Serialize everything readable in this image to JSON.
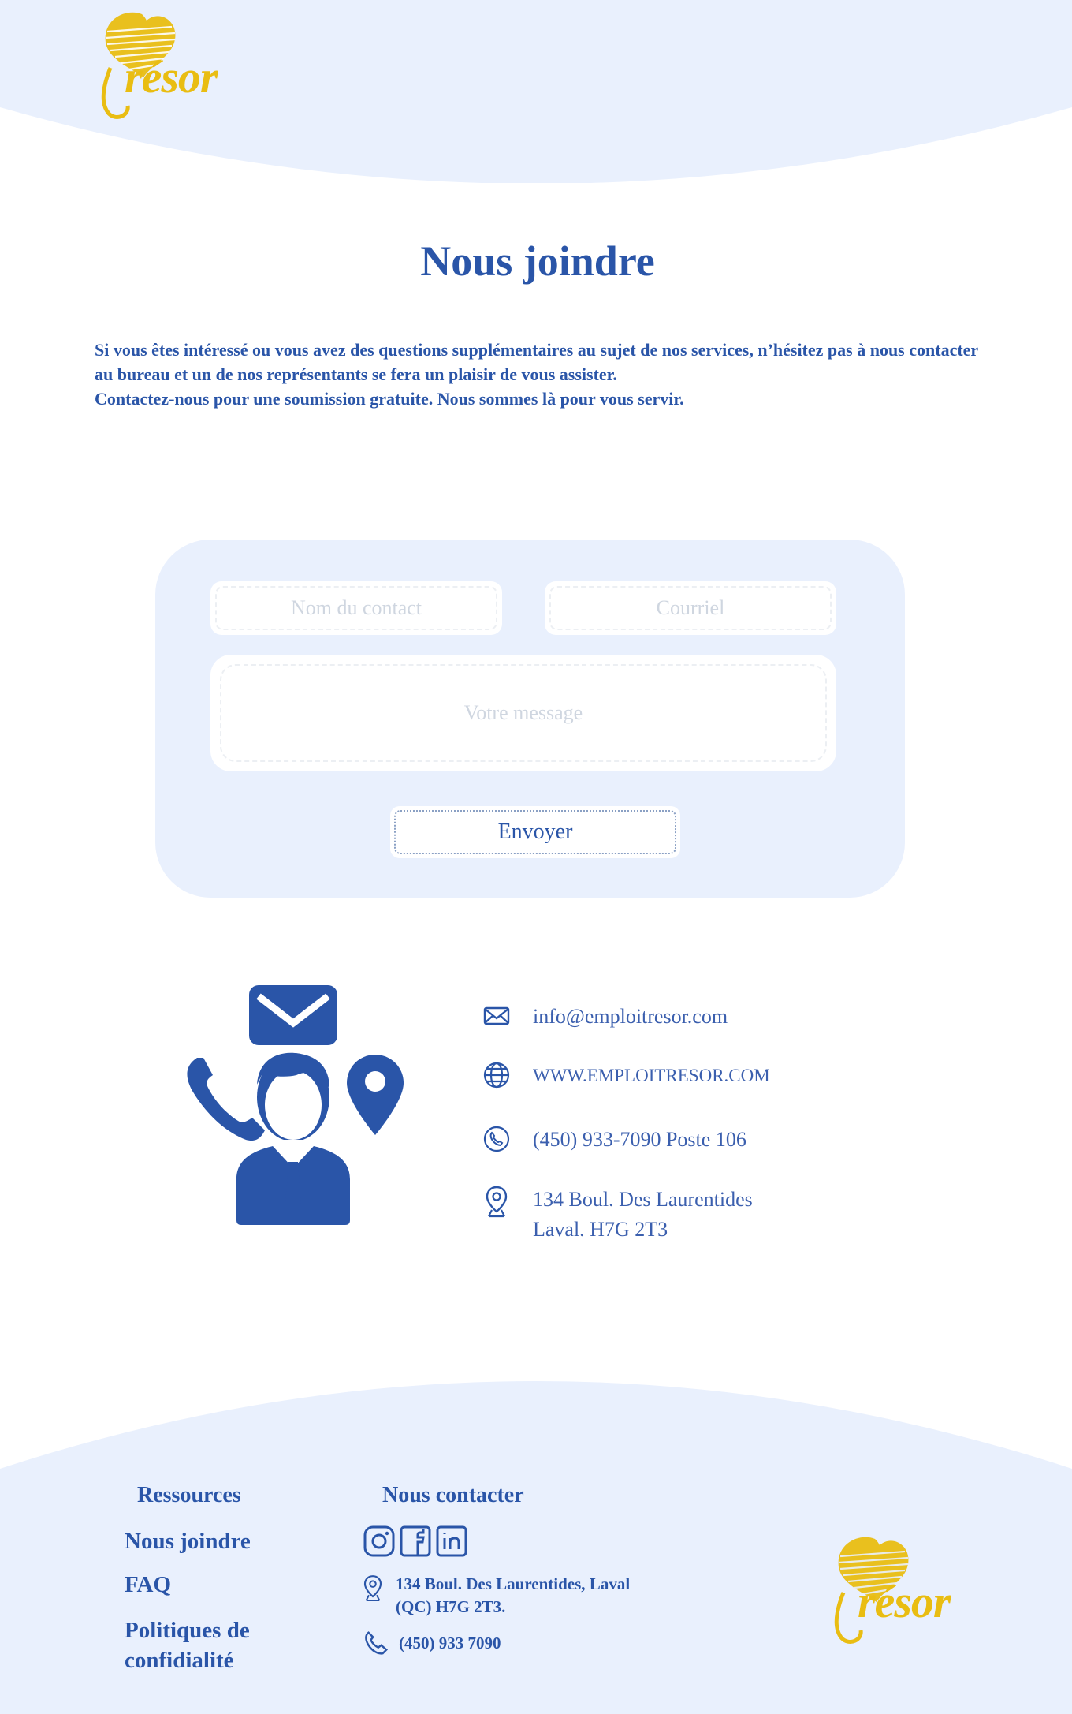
{
  "brand": {
    "logo_text": "rrésor",
    "accent": "#e9bd12",
    "primary": "#2a55a8",
    "panel_bg": "#e9f0fd"
  },
  "page": {
    "title": "Nous joindre",
    "intro_line1": "Si vous êtes intéressé ou vous avez des questions supplémentaires au sujet de nos services, n’hésitez pas à nous contacter au bureau et un de nos représentants se fera un plaisir de vous assister.",
    "intro_line2": "Contactez-nous pour une soumission gratuite. Nous sommes là pour vous servir."
  },
  "form": {
    "name_placeholder": "Nom du contact",
    "email_placeholder": "Courriel",
    "message_placeholder": "Votre message",
    "submit_label": "Envoyer"
  },
  "contact": {
    "email": "info@emploitresor.com",
    "website": "WWW.EMPLOITRESOR.COM",
    "phone": "(450) 933-7090 Poste 106",
    "address_line1": "134 Boul. Des Laurentides",
    "address_line2": "Laval. H7G 2T3"
  },
  "footer": {
    "resources_heading": "Ressources",
    "links": {
      "contact": "Nous joindre",
      "faq": "FAQ",
      "privacy_line1": "Politiques de",
      "privacy_line2": "confidialité"
    },
    "contact_heading": "Nous contacter",
    "social": [
      "instagram-icon",
      "facebook-icon",
      "linkedin-icon"
    ],
    "address_line1": "134 Boul. Des Laurentides, Laval",
    "address_line2": "(QC) H7G 2T3.",
    "phone": "(450) 933 7090"
  }
}
